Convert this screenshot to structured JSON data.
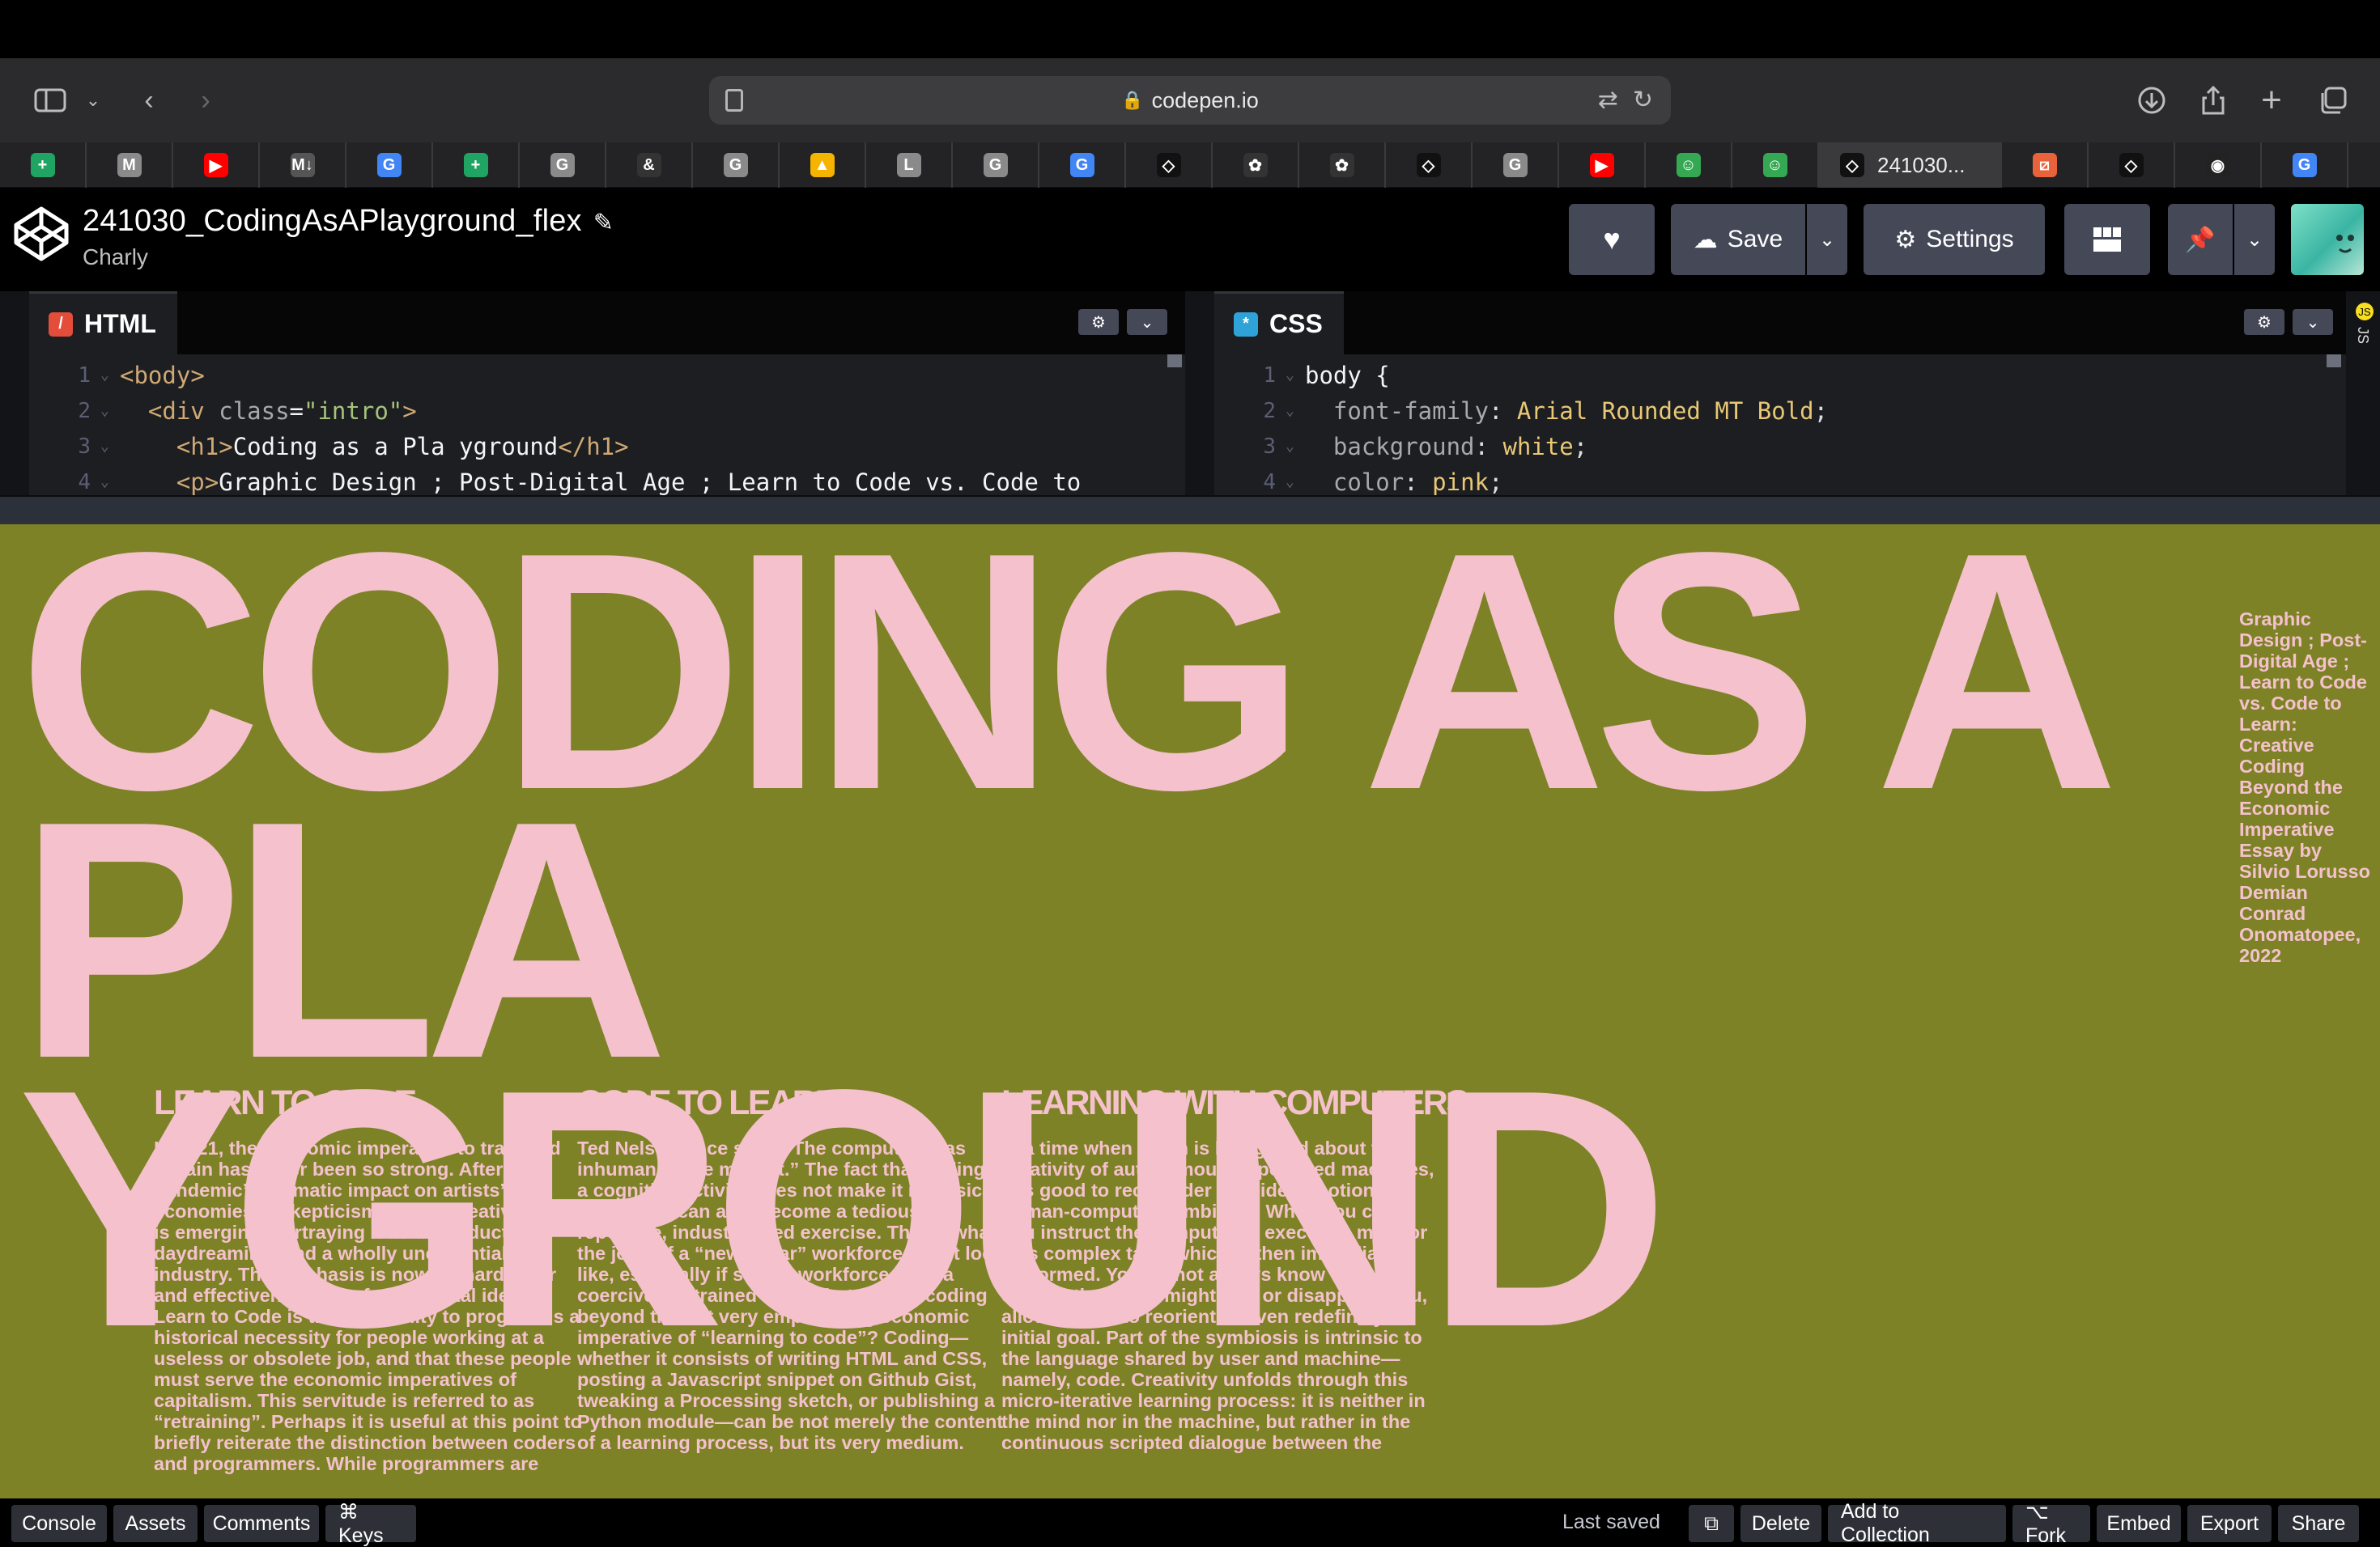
{
  "browser": {
    "url": "codepen.io",
    "active_tab_title": "241030...",
    "tabs": [
      {
        "icon": "sheets-icon",
        "letter": "+",
        "color": "#1fa463"
      },
      {
        "icon": "gmail-icon",
        "letter": "M",
        "color": "#8a8a8a"
      },
      {
        "icon": "youtube-icon",
        "letter": "▶",
        "color": "#ff0000"
      },
      {
        "icon": "markdown-icon",
        "letter": "M↓",
        "color": "#555555"
      },
      {
        "icon": "google-icon",
        "letter": "G",
        "color": "#4285f4"
      },
      {
        "icon": "sheets-icon",
        "letter": "+",
        "color": "#1fa463"
      },
      {
        "icon": "generic-g-icon",
        "letter": "G",
        "color": "#8a8a8a"
      },
      {
        "icon": "ampersand-icon",
        "letter": "&",
        "color": "#333333"
      },
      {
        "icon": "generic-g-icon",
        "letter": "G",
        "color": "#8a8a8a"
      },
      {
        "icon": "drive-icon",
        "letter": "▲",
        "color": "#f4b400"
      },
      {
        "icon": "generic-l-icon",
        "letter": "L",
        "color": "#8a8a8a"
      },
      {
        "icon": "generic-g-icon",
        "letter": "G",
        "color": "#8a8a8a"
      },
      {
        "icon": "google-icon",
        "letter": "G",
        "color": "#4285f4"
      },
      {
        "icon": "codepen-icon",
        "letter": "◇",
        "color": "#111111"
      },
      {
        "icon": "openai-icon",
        "letter": "✿",
        "color": "#333333"
      },
      {
        "icon": "openai-icon",
        "letter": "✿",
        "color": "#333333"
      },
      {
        "icon": "codepen-icon",
        "letter": "◇",
        "color": "#111111"
      },
      {
        "icon": "generic-g-icon",
        "letter": "G",
        "color": "#8a8a8a"
      },
      {
        "icon": "youtube-icon",
        "letter": "▶",
        "color": "#ff0000"
      },
      {
        "icon": "frog-icon",
        "letter": "☺",
        "color": "#35a853"
      },
      {
        "icon": "frog-icon",
        "letter": "☺",
        "color": "#35a853"
      }
    ],
    "tabs_after": [
      {
        "icon": "slash-icon",
        "letter": "⧄",
        "color": "#e8623a"
      },
      {
        "icon": "codepen-icon",
        "letter": "◇",
        "color": "#111111"
      },
      {
        "icon": "circle-logo-icon",
        "letter": "◉",
        "color": "#222222"
      },
      {
        "icon": "google-icon",
        "letter": "G",
        "color": "#4285f4"
      }
    ]
  },
  "codepen": {
    "title": "241030_CodingAsAPlayground_flex",
    "author": "Charly",
    "buttons": {
      "save": "Save",
      "settings": "Settings"
    }
  },
  "editors": {
    "html": {
      "label": "HTML",
      "lines": [
        {
          "n": "1",
          "text": "<body>"
        },
        {
          "n": "2",
          "text": "  <div class=\"intro\">"
        },
        {
          "n": "3",
          "text": "    <h1>Coding as a Pla yground</h1>"
        },
        {
          "n": "4",
          "text": "    <p>Graphic Design ; Post-Digital Age ; Learn to Code vs. Code to"
        }
      ]
    },
    "css": {
      "label": "CSS",
      "lines": [
        {
          "n": "1",
          "text": "body {"
        },
        {
          "n": "2",
          "text": "  font-family: Arial Rounded MT Bold;"
        },
        {
          "n": "3",
          "text": "  background: white;"
        },
        {
          "n": "4",
          "text": "  color: pink;"
        }
      ]
    },
    "js_label": "JS"
  },
  "preview": {
    "colors": {
      "background": "#7d8226",
      "text": "#f4c1cc"
    },
    "title_line1": "CODING AS A",
    "title_line2": "PLA YGROUND",
    "side_note": "Graphic Design ; Post-Digital Age ; Learn to Code vs. Code to Learn: Creative Coding Beyond the Economic Imperative Essay by Silvio Lorusso Demian Conrad Onomatopee, 2022",
    "columns": [
      {
        "heading": "LEARN TO CODE",
        "body": "In 2021, the economic imperative to train and retrain has never been so strong. After the pandemic’s dramatic impact on artists’ economies, a skepticism about “creative” work is emerging, portraying it as unproductive daydreaming, and a wholly unessential industry. The emphasis is now on hard labor and effectiveness. The fundamental idea of Learn to Code is that the ability to program is a historical necessity for people working at a useless or obsolete job, and that these people must serve the economic imperatives of capitalism. This servitude is referred to as “retraining”. Perhaps it is useful at this point to briefly reiterate the distinction between coders and programmers. While programmers are"
      },
      {
        "heading": "CODE TO LEARN",
        "body": "Ted Nelson once said: “The computer is as inhuman as we make it.” The fact that coding is a cognitive activity does not make it intrinsically humane. It can also become a tedious, repetitive, industrialized exercise. This is what the jobs of a “new collar” workforce might look like, especially if such a workforce were a coercively retrained one. What then is coding beyond the not very empowering economic imperative of “learning to code”? Coding— whether it consists of writing HTML and CSS, posting a Javascript snippet on Github Gist, tweaking a Processing sketch, or publishing a Python module—can be not merely the content of a learning process, but its very medium."
      },
      {
        "heading": "LEARNING WITH COMPUTERS",
        "body": "In a time when much is being said about the creativity of autonomous AI-powered machines, it is good to reconsider Licklider’s notion of human-computer symbiosis. When you code, you instruct the computer to execute a more or less complex task, which is then immediately performed. You do not always know what to expect: the result might awe or disappoint you, allowing you to reorient or even redefine your initial goal. Part of the symbiosis is intrinsic to the language shared by user and machine— namely, code. Creativity unfolds through this micro-iterative learning process: it is neither in the mind nor in the machine, but rather in the continuous scripted dialogue between the"
      }
    ]
  },
  "footer": {
    "console": "Console",
    "assets": "Assets",
    "comments": "Comments",
    "keys": "⌘ Keys",
    "last_saved": "Last saved",
    "delete": "Delete",
    "add_to_collection": "Add to Collection",
    "fork": "⌥ Fork",
    "embed": "Embed",
    "export": "Export",
    "share": "Share"
  }
}
